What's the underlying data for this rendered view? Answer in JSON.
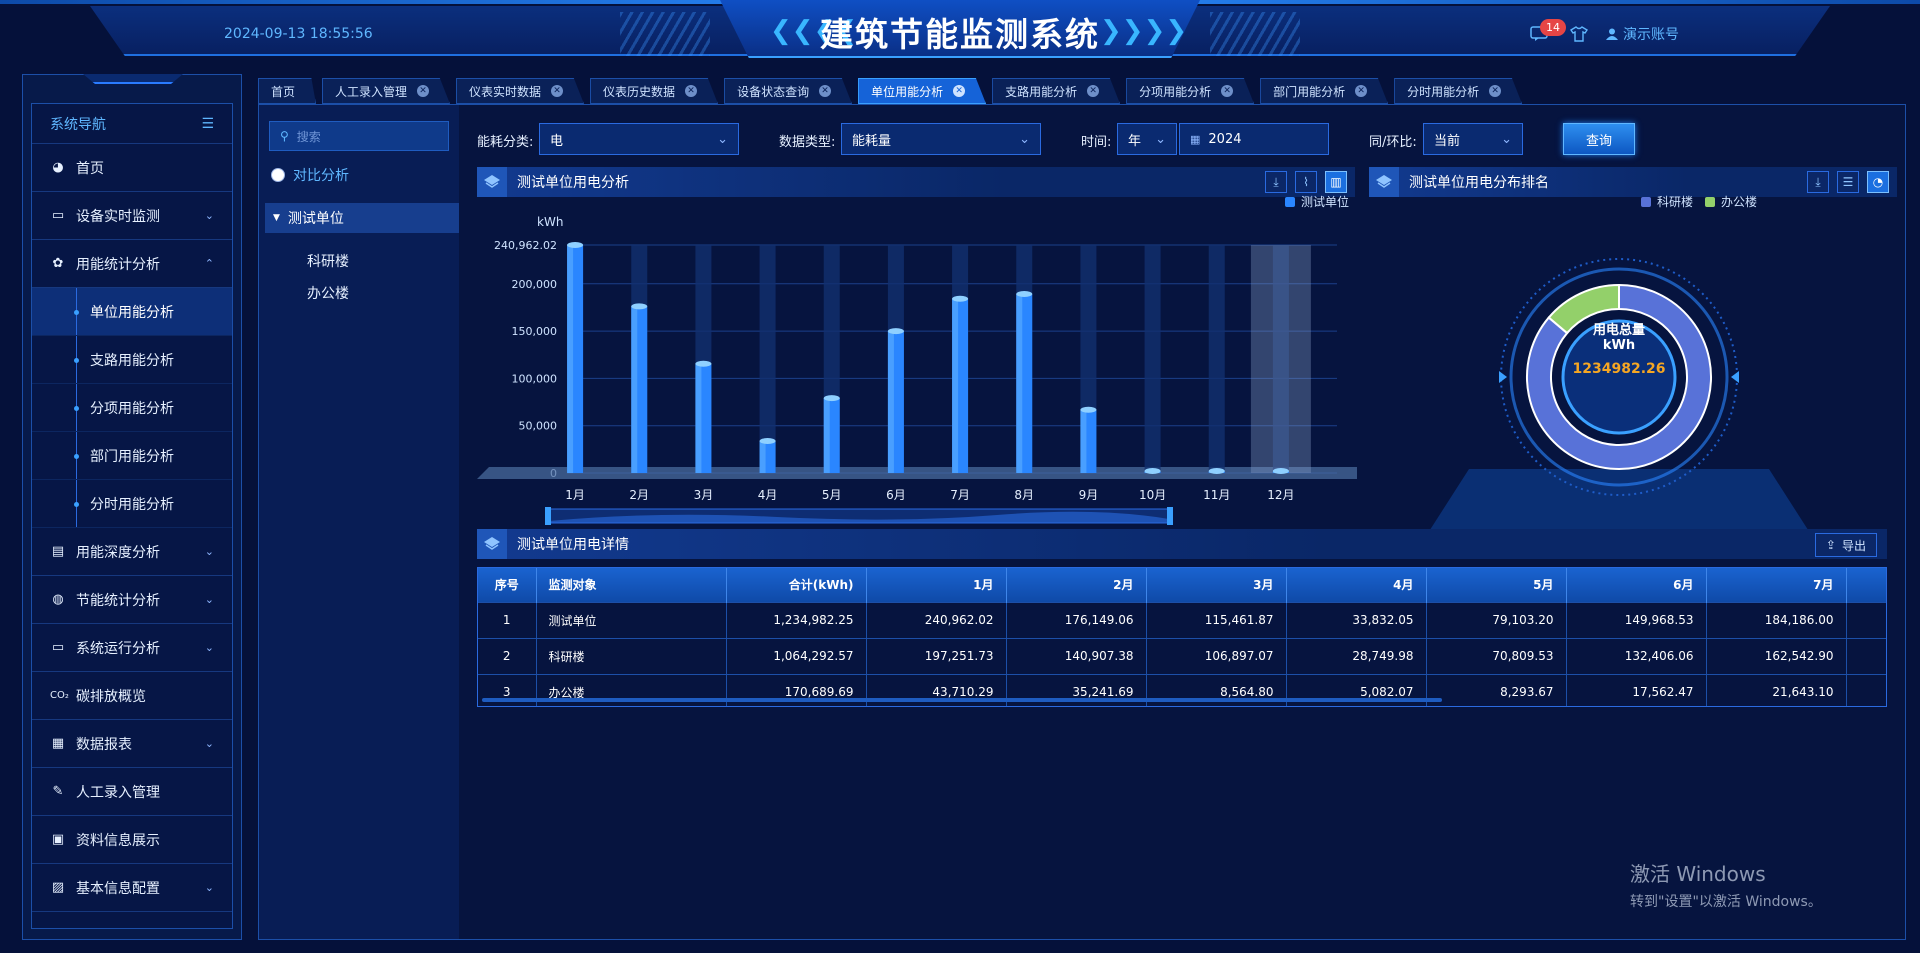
{
  "header": {
    "datetime": "2024-09-13 18:55:56",
    "title": "建筑节能监测系统",
    "chev_left": "❮❮❮❮",
    "chev_right": "❯❯❯❯",
    "message_count": "14",
    "user": "演示账号"
  },
  "sidebar": {
    "title": "系统导航",
    "items": [
      {
        "label": "首页",
        "icon": "dashboard-icon"
      },
      {
        "label": "设备实时监测",
        "icon": "monitor-icon"
      },
      {
        "label": "用能统计分析",
        "icon": "cog-icon"
      },
      {
        "label": "用能深度分析",
        "icon": "chart-icon"
      },
      {
        "label": "节能统计分析",
        "icon": "globe-icon"
      },
      {
        "label": "系统运行分析",
        "icon": "monitor-icon"
      },
      {
        "label": "碳排放概览",
        "icon": "co2-icon"
      },
      {
        "label": "数据报表",
        "icon": "report-icon"
      },
      {
        "label": "人工录入管理",
        "icon": "edit-icon"
      },
      {
        "label": "资料信息展示",
        "icon": "id-card-icon"
      },
      {
        "label": "基本信息配置",
        "icon": "config-icon"
      }
    ],
    "sub_items": [
      "单位用能分析",
      "支路用能分析",
      "分项用能分析",
      "部门用能分析",
      "分时用能分析"
    ]
  },
  "tabs": [
    "首页",
    "人工录入管理",
    "仪表实时数据",
    "仪表历史数据",
    "设备状态查询",
    "单位用能分析",
    "支路用能分析",
    "分项用能分析",
    "部门用能分析",
    "分时用能分析"
  ],
  "tree": {
    "search_placeholder": "搜索",
    "compare_label": "对比分析",
    "root": "测试单位",
    "children": [
      "科研楼",
      "办公楼"
    ]
  },
  "filters": {
    "energy_type_label": "能耗分类:",
    "energy_type_value": "电",
    "data_type_label": "数据类型:",
    "data_type_value": "能耗量",
    "time_label": "时间:",
    "time_unit": "年",
    "time_value": "2024",
    "compare_label": "同/环比:",
    "compare_value": "当前",
    "query_button": "查询"
  },
  "left_panel_title": "测试单位用电分析",
  "right_panel_title": "测试单位用电分布排名",
  "detail_panel_title": "测试单位用电详情",
  "export_label": "导出",
  "colors": {
    "bar": "#2a86ff",
    "donut_research": "#5872d8",
    "donut_office": "#93d06a",
    "accent": "#5fb7ff",
    "total_value": "#f5a623"
  },
  "chart_data": [
    {
      "type": "bar",
      "ylabel": "kWh",
      "ylim": [
        0,
        240962.02
      ],
      "y_ticks": [
        "240,962.02",
        "200,000",
        "150,000",
        "100,000",
        "50,000",
        "0"
      ],
      "categories": [
        "1月",
        "2月",
        "3月",
        "4月",
        "5月",
        "6月",
        "7月",
        "8月",
        "9月",
        "10月",
        "11月",
        "12月"
      ],
      "series": [
        {
          "name": "测试单位",
          "values": [
            240962.02,
            176149.06,
            115461.87,
            33832.05,
            79103.2,
            149968.53,
            184186.0,
            189200,
            66800,
            0,
            0,
            0
          ]
        }
      ],
      "legend": "top-right"
    },
    {
      "type": "pie",
      "center_label": "用电总量",
      "center_unit": "kWh",
      "center_value": "1234982.26",
      "slices": [
        {
          "name": "科研楼",
          "value": 1064292.57
        },
        {
          "name": "办公楼",
          "value": 170689.69
        }
      ],
      "legend": "top-right"
    }
  ],
  "table": {
    "columns": [
      "序号",
      "监测对象",
      "合计(kWh)",
      "1月",
      "2月",
      "3月",
      "4月",
      "5月",
      "6月",
      "7月"
    ],
    "rows": [
      [
        "1",
        "测试单位",
        "1,234,982.25",
        "240,962.02",
        "176,149.06",
        "115,461.87",
        "33,832.05",
        "79,103.20",
        "149,968.53",
        "184,186.00"
      ],
      [
        "2",
        "科研楼",
        "1,064,292.57",
        "197,251.73",
        "140,907.38",
        "106,897.07",
        "28,749.98",
        "70,809.53",
        "132,406.06",
        "162,542.90"
      ],
      [
        "3",
        "办公楼",
        "170,689.69",
        "43,710.29",
        "35,241.69",
        "8,564.80",
        "5,082.07",
        "8,293.67",
        "17,562.47",
        "21,643.10"
      ]
    ]
  },
  "watermark": {
    "line1": "激活 Windows",
    "line2": "转到\"设置\"以激活 Windows。"
  }
}
